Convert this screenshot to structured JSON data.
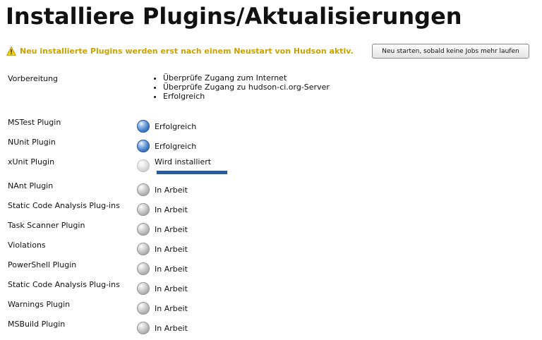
{
  "page_title": "Installiere Plugins/Aktualisierungen",
  "notice": {
    "text": "Neu installierte Plugins werden erst nach einem Neustart von Hudson aktiv.",
    "icon": "warning-icon",
    "color": "#c8a200"
  },
  "restart_button": {
    "label": "Neu starten, sobald keine Jobs mehr laufen"
  },
  "preparation": {
    "label": "Vorbereitung",
    "items": [
      "Überprüfe Zugang zum Internet",
      "Überprüfe Zugang zu hudson-ci.org-Server",
      "Erfolgreich"
    ]
  },
  "plugins": [
    {
      "name": "MSTest Plugin",
      "status": "Erfolgreich",
      "state": "success"
    },
    {
      "name": "NUnit Plugin",
      "status": "Erfolgreich",
      "state": "success"
    },
    {
      "name": "xUnit Plugin",
      "status": "Wird installiert",
      "state": "installing",
      "progress": 1.0
    },
    {
      "name": "NAnt Plugin",
      "status": "In Arbeit",
      "state": "pending"
    },
    {
      "name": "Static Code Analysis Plug-ins",
      "status": "In Arbeit",
      "state": "pending"
    },
    {
      "name": "Task Scanner Plugin",
      "status": "In Arbeit",
      "state": "pending"
    },
    {
      "name": "Violations",
      "status": "In Arbeit",
      "state": "pending"
    },
    {
      "name": "PowerShell Plugin",
      "status": "In Arbeit",
      "state": "pending"
    },
    {
      "name": "Static Code Analysis Plug-ins",
      "status": "In Arbeit",
      "state": "pending"
    },
    {
      "name": "Warnings Plugin",
      "status": "In Arbeit",
      "state": "pending"
    },
    {
      "name": "MSBuild Plugin",
      "status": "In Arbeit",
      "state": "pending"
    }
  ],
  "colors": {
    "success_ball": "#4a82cc",
    "pending_ball": "#b4b4b4",
    "progress": "#2a5a98"
  }
}
